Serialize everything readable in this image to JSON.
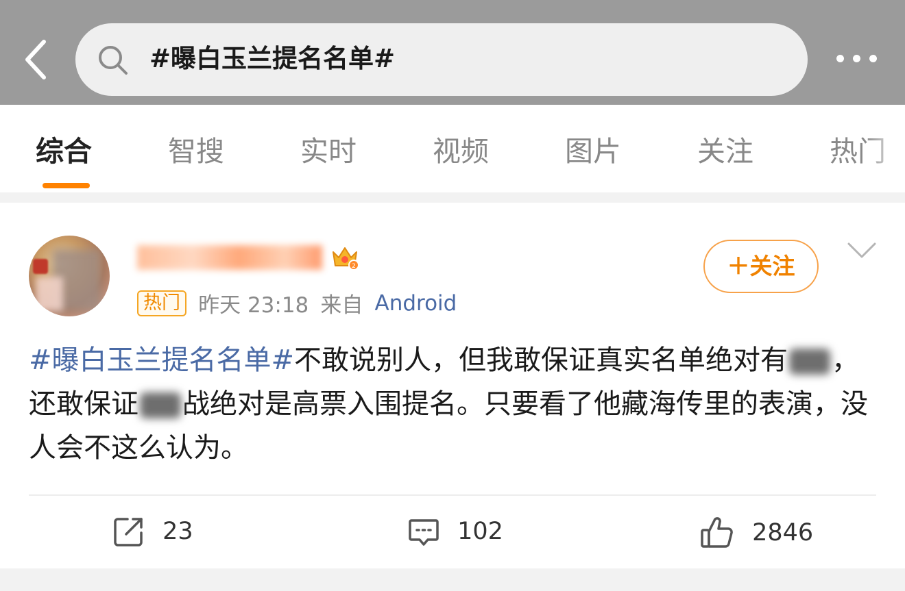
{
  "search": {
    "query": "#曝白玉兰提名名单#"
  },
  "tabs": [
    {
      "label": "综合"
    },
    {
      "label": "智搜"
    },
    {
      "label": "实时"
    },
    {
      "label": "视频"
    },
    {
      "label": "图片"
    },
    {
      "label": "关注"
    },
    {
      "label": "热门"
    }
  ],
  "post": {
    "author": {
      "name": "",
      "badge_icon": "crown-badge-icon"
    },
    "meta": {
      "hot_label": "热门",
      "time": "昨天 23:18",
      "via": "来自",
      "source": "Android"
    },
    "follow_label": "＋关注",
    "text": {
      "hashtag": "#曝白玉兰提名名单#",
      "part1": "不敢说别人，但我敢保证真实名单绝对有",
      "part2": "，还敢保证",
      "part3": "战绝对是高票入围提名。只要看了他藏海传里的表演，没人会不这么认为。"
    },
    "stats": {
      "reposts": "23",
      "comments": "102",
      "likes": "2846"
    }
  },
  "colors": {
    "accent": "#ff8200",
    "link": "#4a6aa5",
    "topbar": "#9b9b9b"
  }
}
